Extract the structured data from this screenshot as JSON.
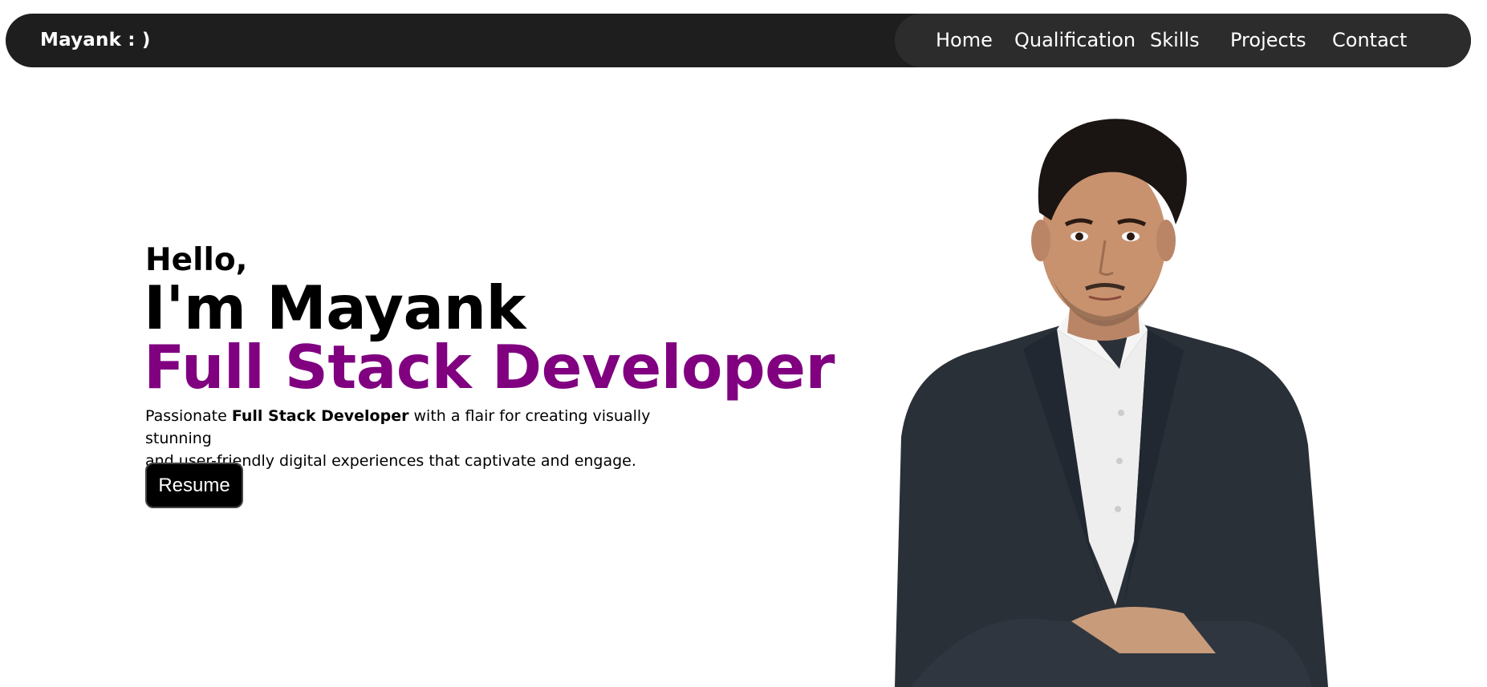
{
  "navbar": {
    "brand": "Mayank : )",
    "links": [
      "Home",
      "Qualification",
      "Skills",
      "Projects",
      "Contact"
    ]
  },
  "hero": {
    "greeting": "Hello,",
    "name_line": "I'm Mayank",
    "role": "Full Stack Developer",
    "tagline_start": "Passionate ",
    "tagline_bold": "Full Stack Developer",
    "tagline_end": " with a flair for creating visually stunning",
    "tagline_line2": "and user-friendly digital experiences that captivate and engage.",
    "resume_label": "Resume"
  },
  "colors": {
    "navbar_bg": "#1e1e1e",
    "nav_panel_bg": "#2c2c2c",
    "accent_purple": "#800080",
    "button_bg": "#000000"
  },
  "icons": {
    "portrait": "profile-photo"
  }
}
